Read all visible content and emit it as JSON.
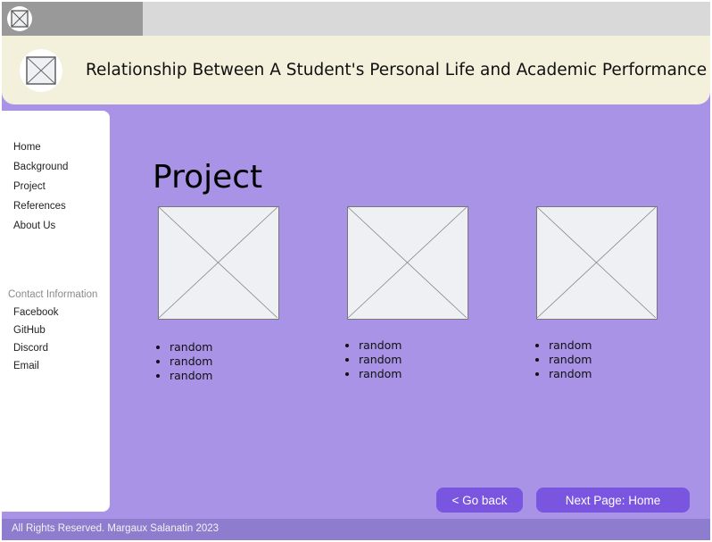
{
  "header": {
    "title": "Relationship Between A Student's Personal Life and Academic Performance"
  },
  "sidebar": {
    "nav_items": [
      {
        "label": "Home"
      },
      {
        "label": "Background"
      },
      {
        "label": "Project"
      },
      {
        "label": "References"
      },
      {
        "label": "About Us"
      }
    ],
    "contact": {
      "heading": "Contact Information",
      "items": [
        {
          "label": "Facebook"
        },
        {
          "label": "GitHub"
        },
        {
          "label": "Discord"
        },
        {
          "label": "Email"
        }
      ]
    }
  },
  "main": {
    "title": "Project",
    "cards": [
      {
        "icon": "image-placeholder-icon",
        "bullets": [
          "random",
          "random",
          "random"
        ]
      },
      {
        "icon": "image-placeholder-icon",
        "bullets": [
          "random",
          "random",
          "random"
        ]
      },
      {
        "icon": "image-placeholder-icon",
        "bullets": [
          "random",
          "random",
          "random"
        ]
      }
    ]
  },
  "buttons": {
    "back_label": "< Go back",
    "next_label": "Next Page: Home"
  },
  "footer": {
    "text": "All Rights Reserved. Margaux Salanatin 2023"
  },
  "colors": {
    "content_bg": "#a893e6",
    "header_bg": "#f3f0dc",
    "button_bg": "#7a55e0",
    "footer_bg": "#8e7ccf"
  }
}
